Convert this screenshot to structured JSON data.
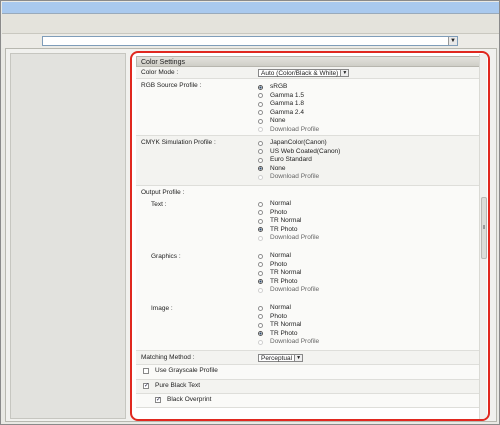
{
  "settings": {
    "title": "Color Settings",
    "color_mode": {
      "label": "Color Mode :",
      "value": "Auto (Color/Black & White)"
    },
    "rgb_source": {
      "label": "RGB Source Profile :",
      "options": [
        "sRGB",
        "Gamma 1.5",
        "Gamma 1.8",
        "Gamma 2.4",
        "None",
        "Download Profile"
      ]
    },
    "cmyk_sim": {
      "label": "CMYK Simulation Profile :",
      "options": [
        "JapanColor(Canon)",
        "US Web Coated(Canon)",
        "Euro Standard",
        "None",
        "Download Profile"
      ]
    },
    "output_profile": {
      "label": "Output Profile :",
      "text": {
        "label": "Text :",
        "options": [
          "Normal",
          "Photo",
          "TR Normal",
          "TR Photo",
          "Download Profile"
        ]
      },
      "graphics": {
        "label": "Graphics :",
        "options": [
          "Normal",
          "Photo",
          "TR Normal",
          "TR Photo",
          "Download Profile"
        ]
      },
      "image": {
        "label": "Image :",
        "options": [
          "Normal",
          "Photo",
          "TR Normal",
          "TR Photo",
          "Download Profile"
        ]
      }
    },
    "matching_method": {
      "label": "Matching Method :",
      "value": "Perceptual"
    },
    "use_grayscale": {
      "label": "Use Grayscale Profile"
    },
    "pure_black": {
      "label": "Pure Black Text"
    },
    "black_overprint": {
      "label": "Black Overprint"
    }
  }
}
